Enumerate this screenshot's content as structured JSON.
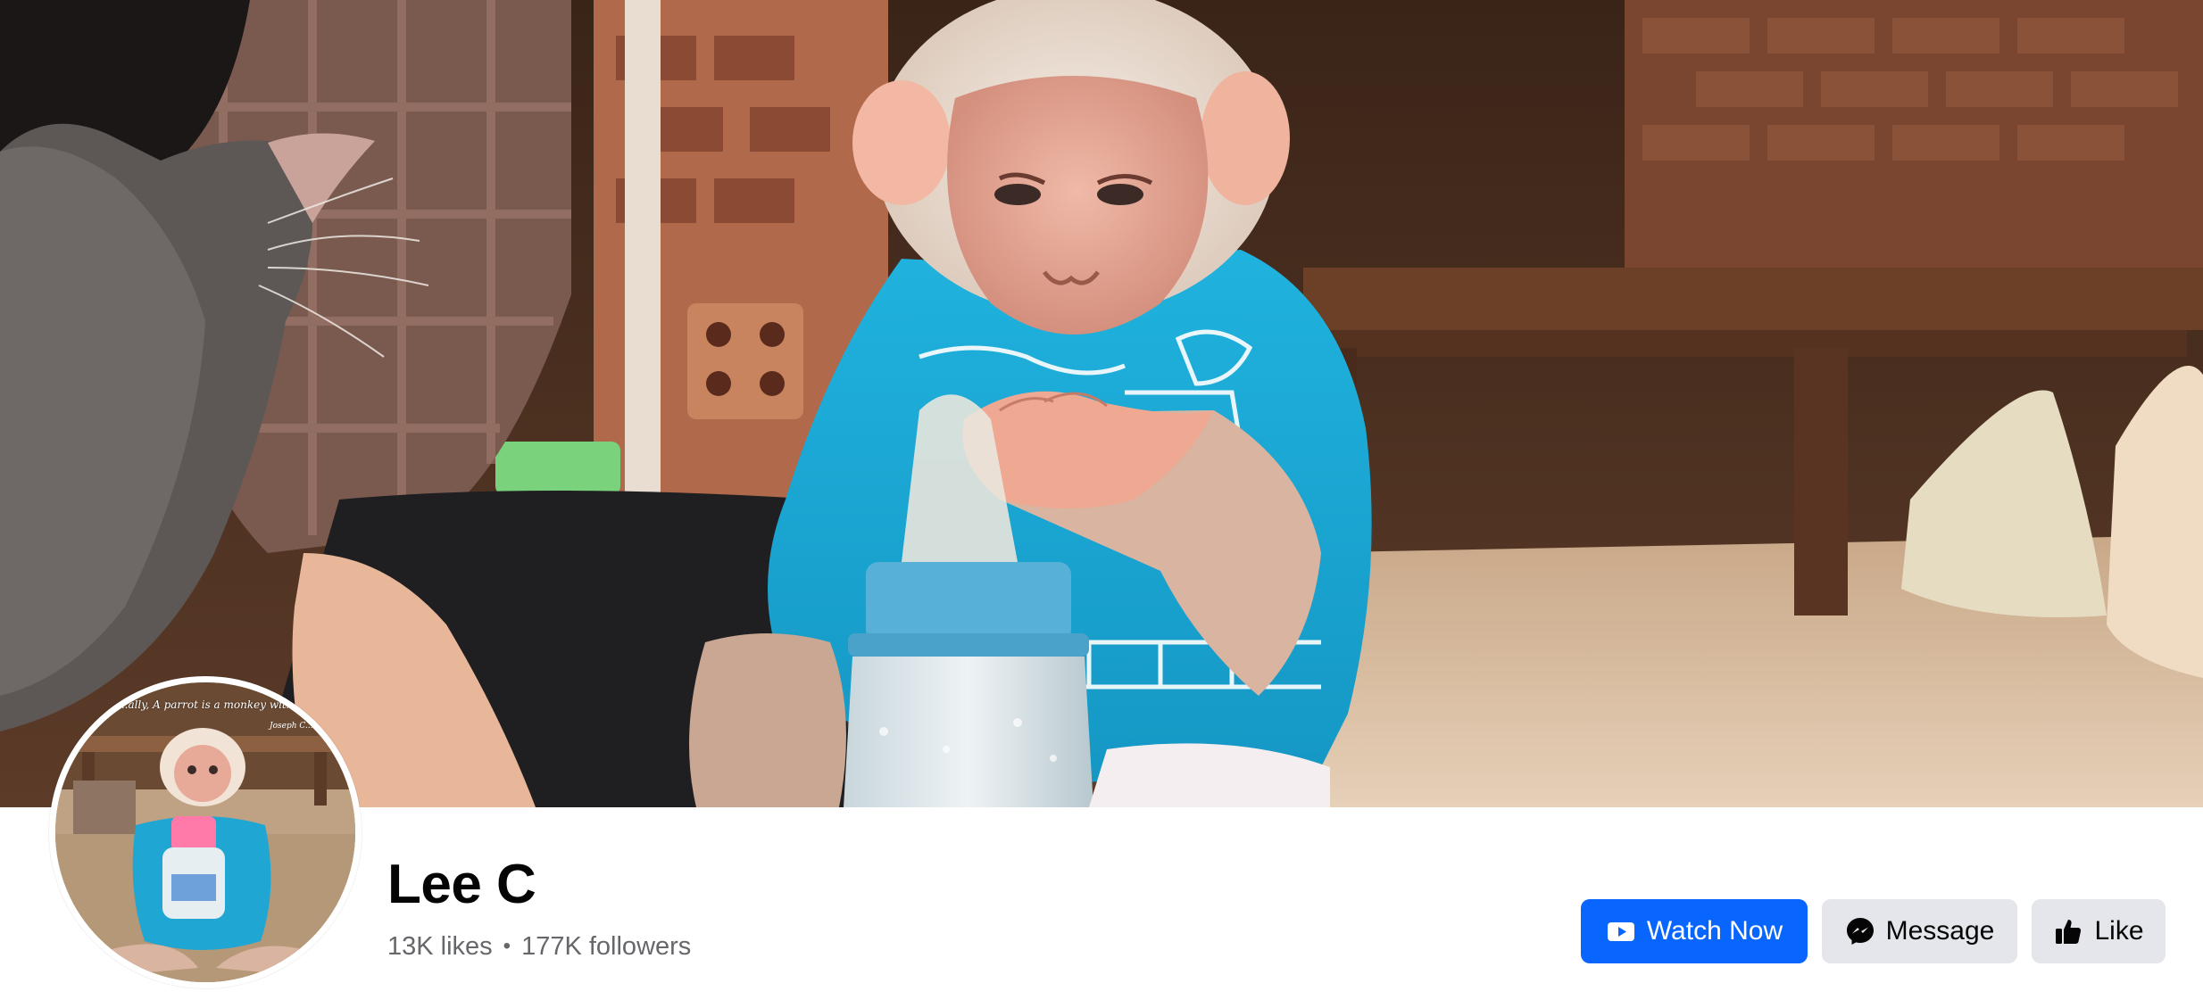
{
  "page": {
    "name": "Lee C",
    "likes": "13K likes",
    "separator": "•",
    "followers": "177K followers"
  },
  "profile_picture": {
    "quote_text": "...ally, A parrot is a monkey with...",
    "quote_author": "Joseph C..."
  },
  "actions": {
    "watch_now": "Watch Now",
    "message": "Message",
    "like": "Like"
  },
  "icons": {
    "watch": "play-video-icon",
    "message": "messenger-icon",
    "like": "thumbs-up-icon"
  },
  "colors": {
    "primary": "#0866ff",
    "secondary_bg": "#e4e6eb",
    "text": "#050505",
    "muted": "#65676b"
  }
}
